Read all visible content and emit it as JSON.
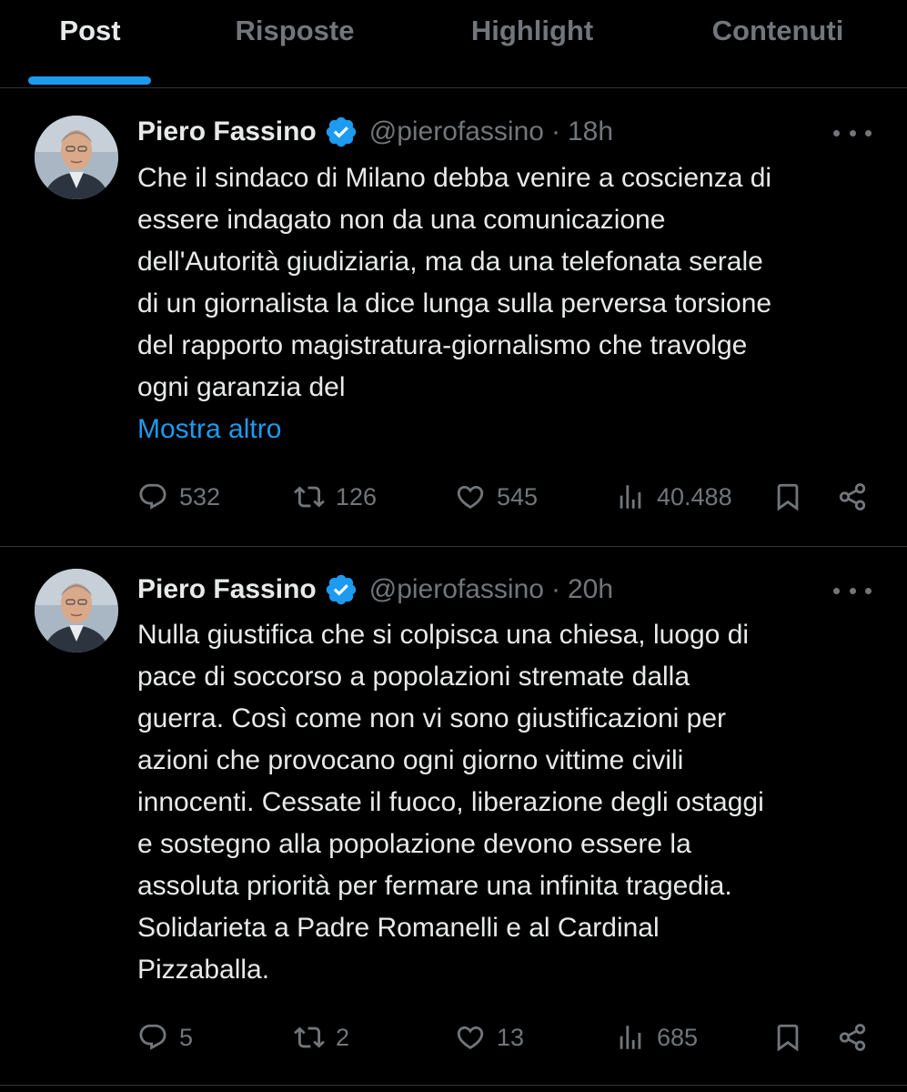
{
  "tabs": [
    {
      "label": "Post",
      "active": true
    },
    {
      "label": "Risposte",
      "active": false
    },
    {
      "label": "Highlight",
      "active": false
    },
    {
      "label": "Contenuti",
      "active": false
    }
  ],
  "colors": {
    "background": "#000000",
    "text": "#e7e9ea",
    "muted": "#71767b",
    "accent": "#1d9bf0",
    "divider": "#2f3336"
  },
  "tweets": [
    {
      "author": "Piero Fassino",
      "handle": "@pierofassino",
      "separator": "·",
      "time": "18h",
      "verified_icon": "verified-badge-icon",
      "text": "Che il sindaco di Milano debba venire a coscienza di\nessere indagato non da una comunicazione\ndell'Autorità giudiziaria, ma da una telefonata serale\ndi un giornalista la dice lunga sulla perversa torsione\ndel rapporto magistratura-giornalismo che travolge\nogni garanzia del",
      "show_more": "Mostra altro",
      "replies": "532",
      "reposts": "126",
      "likes": "545",
      "views": "40.488"
    },
    {
      "author": "Piero Fassino",
      "handle": "@pierofassino",
      "separator": "·",
      "time": "20h",
      "verified_icon": "verified-badge-icon",
      "text": "Nulla giustifica che si colpisca una chiesa, luogo di\npace di soccorso a popolazioni stremate dalla\nguerra. Così come non vi sono giustificazioni per\nazioni che provocano ogni giorno vittime civili\ninnocenti. Cessate il fuoco, liberazione degli ostaggi\ne sostegno alla popolazione devono essere la\nassoluta priorità per fermare una infinita tragedia.\nSolidarieta a Padre Romanelli e al Cardinal\nPizzaballa.",
      "replies": "5",
      "reposts": "2",
      "likes": "13",
      "views": "685"
    }
  ]
}
